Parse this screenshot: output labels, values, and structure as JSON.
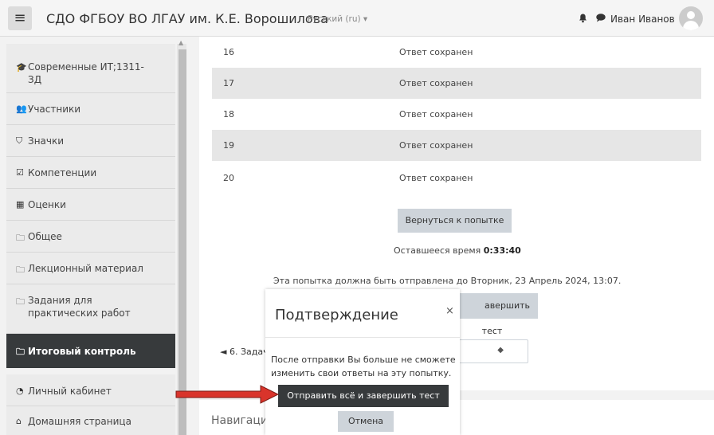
{
  "navbar": {
    "menu_icon": "hamburger-icon",
    "site_title": "СДО ФГБОУ ВО ЛГАУ им. К.Е. Ворошилова",
    "language": "Русский (ru) ▾",
    "bell_icon": "bell-icon",
    "chat_icon": "chat-icon",
    "user_name": "Иван Иванов"
  },
  "sidebar": {
    "items": [
      {
        "icon": "graduation-cap-icon",
        "label": "Современные ИТ;1311-\nЗД"
      },
      {
        "icon": "users-icon",
        "label": "Участники"
      },
      {
        "icon": "shield-icon",
        "label": "Значки"
      },
      {
        "icon": "checkbox-icon",
        "label": "Компетенции"
      },
      {
        "icon": "table-icon",
        "label": "Оценки"
      },
      {
        "icon": "folder-icon",
        "label": "Общее"
      },
      {
        "icon": "folder-icon",
        "label": "Лекционный материал"
      },
      {
        "icon": "folder-icon",
        "label": "Задания для\nпрактических работ"
      },
      {
        "icon": "folder-icon",
        "label": "Итоговый контроль"
      },
      {
        "icon": "dashboard-icon",
        "label": "Личный кабинет"
      },
      {
        "icon": "home-icon",
        "label": "Домашняя страница"
      }
    ]
  },
  "summary": {
    "rows": [
      {
        "num": "16",
        "status": "Ответ сохранен"
      },
      {
        "num": "17",
        "status": "Ответ сохранен"
      },
      {
        "num": "18",
        "status": "Ответ сохранен"
      },
      {
        "num": "19",
        "status": "Ответ сохранен"
      },
      {
        "num": "20",
        "status": "Ответ сохранен"
      }
    ],
    "return_button": "Вернуться к попытке",
    "time_label": "Оставшееся время",
    "time_value": "0:33:40",
    "deadline": "Эта попытка должна быть отправлена до Вторник, 23 Апрель 2024, 13:07.",
    "submit_button_partial": "авершить тест",
    "prev_link": "◄ 6. Задач",
    "navigation_label": "Навигаци"
  },
  "modal": {
    "title": "Подтверждение",
    "close": "×",
    "text": "После отправки Вы больше не сможете изменить свои ответы на эту попытку.",
    "confirm_button": "Отправить всё и завершить тест",
    "cancel_button": "Отмена"
  },
  "colors": {
    "active_nav": "#373a3c",
    "button_grey": "#ced4da",
    "arrow": "#d9342b"
  }
}
